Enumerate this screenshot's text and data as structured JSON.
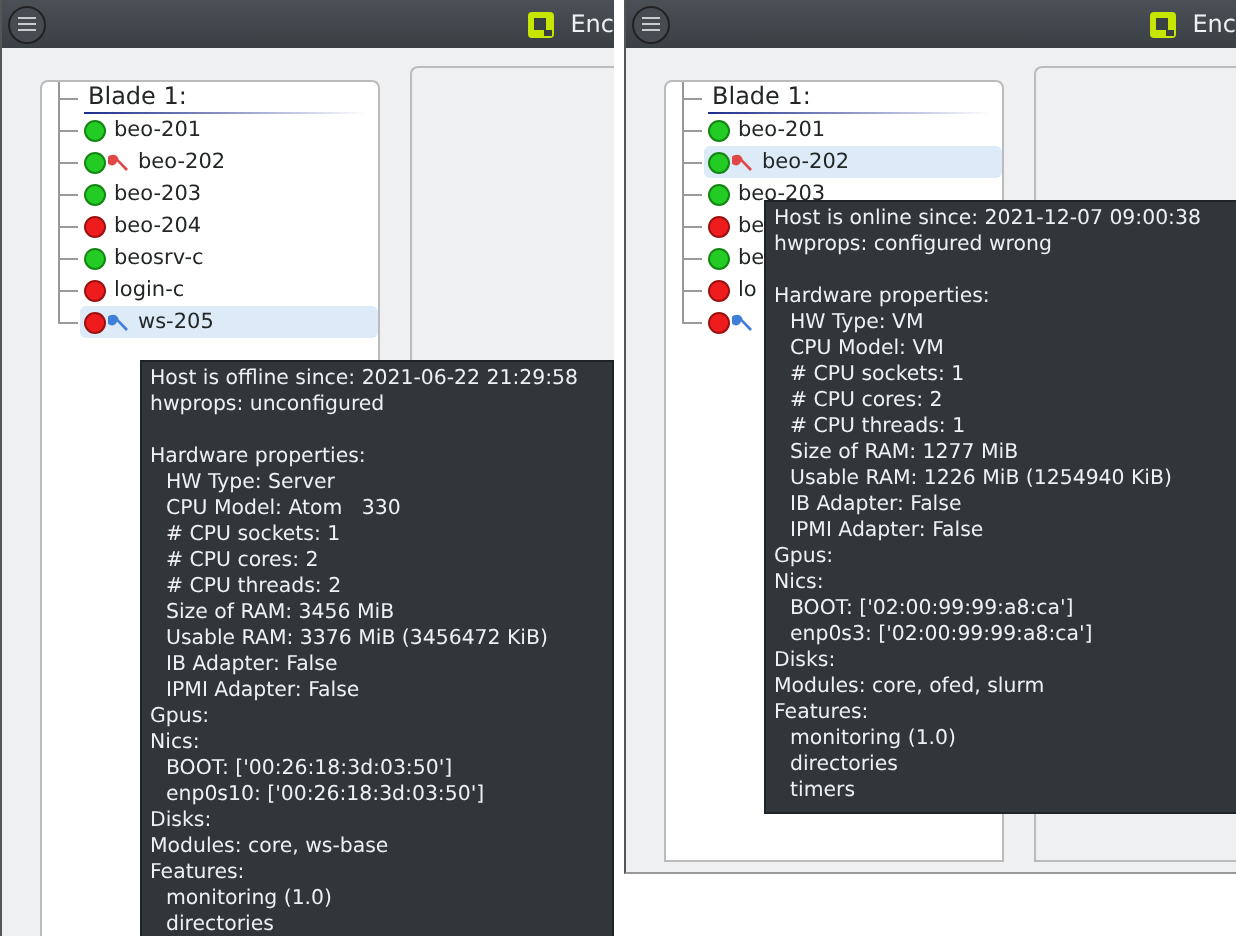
{
  "windows": [
    {
      "title": "Enc",
      "tree": {
        "header": "Blade 1:",
        "items": [
          {
            "label": "beo-201",
            "color": "#22cc22",
            "selected": false
          },
          {
            "label": "beo-202",
            "color": "#22cc22",
            "wrench": {
              "color": "#e04848"
            },
            "selected": false
          },
          {
            "label": "beo-203",
            "color": "#22cc22",
            "selected": false
          },
          {
            "label": "beo-204",
            "color": "#ee1c1c",
            "selected": false
          },
          {
            "label": "beosrv-c",
            "color": "#22cc22",
            "selected": false
          },
          {
            "label": "login-c",
            "color": "#ee1c1c",
            "selected": false
          },
          {
            "label": "ws-205",
            "color": "#ee1c1c",
            "wrench": {
              "color": "#3f7fd8"
            },
            "selected": true
          }
        ]
      },
      "tooltip": {
        "lines": [
          "Host is offline since: 2021-06-22 21:29:58",
          "hwprops: unconfigured"
        ],
        "sections": [
          {
            "title": "Hardware properties:",
            "children": [
              "HW Type: Server",
              "CPU Model: Atom   330",
              "# CPU sockets: 1",
              "# CPU cores: 2",
              "# CPU threads: 2",
              "Size of RAM: 3456 MiB",
              "Usable RAM: 3376 MiB (3456472 KiB)",
              "IB Adapter: False",
              "IPMI Adapter: False"
            ]
          },
          {
            "title": "Gpus:"
          },
          {
            "title": "Nics:",
            "children": [
              "BOOT: ['00:26:18:3d:03:50']",
              "enp0s10: ['00:26:18:3d:03:50']"
            ]
          },
          {
            "title": "Disks:"
          },
          {
            "title": "Modules: core, ws-base"
          },
          {
            "title": "Features:",
            "children": [
              "monitoring (1.0)",
              "directories"
            ]
          }
        ]
      }
    },
    {
      "title": "Enc",
      "tree": {
        "header": "Blade 1:",
        "items": [
          {
            "label": "beo-201",
            "color": "#22cc22",
            "selected": false
          },
          {
            "label": "beo-202",
            "color": "#22cc22",
            "wrench": {
              "color": "#e04848"
            },
            "selected": true
          },
          {
            "label": "beo-203",
            "color": "#22cc22",
            "selected": false
          },
          {
            "label": "be",
            "color": "#ee1c1c",
            "selected": false
          },
          {
            "label": "be",
            "color": "#22cc22",
            "selected": false
          },
          {
            "label": "lo",
            "color": "#ee1c1c",
            "selected": false
          },
          {
            "color": "#ee1c1c",
            "wrench": {
              "color": "#3f7fd8"
            },
            "selected": false
          }
        ]
      },
      "tooltip": {
        "lines": [
          "Host is online since: 2021-12-07 09:00:38",
          "hwprops: configured wrong"
        ],
        "sections": [
          {
            "title": "Hardware properties:",
            "children": [
              "HW Type: VM",
              "CPU Model: VM",
              "# CPU sockets: 1",
              "# CPU cores: 2",
              "# CPU threads: 1",
              "Size of RAM: 1277 MiB",
              "Usable RAM: 1226 MiB (1254940 KiB)",
              "IB Adapter: False",
              "IPMI Adapter: False"
            ]
          },
          {
            "title": "Gpus:"
          },
          {
            "title": "Nics:",
            "children": [
              "BOOT: ['02:00:99:99:a8:ca']",
              "enp0s3: ['02:00:99:99:a8:ca']"
            ]
          },
          {
            "title": "Disks:"
          },
          {
            "title": "Modules: core, ofed, slurm"
          },
          {
            "title": "Features:",
            "children": [
              "monitoring (1.0)",
              "directories",
              "timers"
            ]
          }
        ]
      }
    }
  ]
}
